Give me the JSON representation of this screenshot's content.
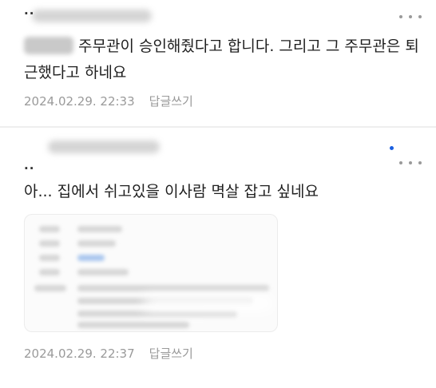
{
  "comments": [
    {
      "nick_visible": "..",
      "text_after_name": "주무관이 승인해줬다고 합니다. 그리고 그 주무관은 퇴근했다고 하네요",
      "date": "2024.02.29. 22:33",
      "reply_label": "답글쓰기",
      "more_icon": "more-dots-icon"
    },
    {
      "nick_visible": "..",
      "text": "아... 집에서 쉬고있을 이사람 멱살 잡고 싶네요",
      "date": "2024.02.29. 22:37",
      "reply_label": "답글쓰기",
      "more_icon": "more-dots-icon",
      "new_indicator_color": "#1a5fe0"
    }
  ]
}
